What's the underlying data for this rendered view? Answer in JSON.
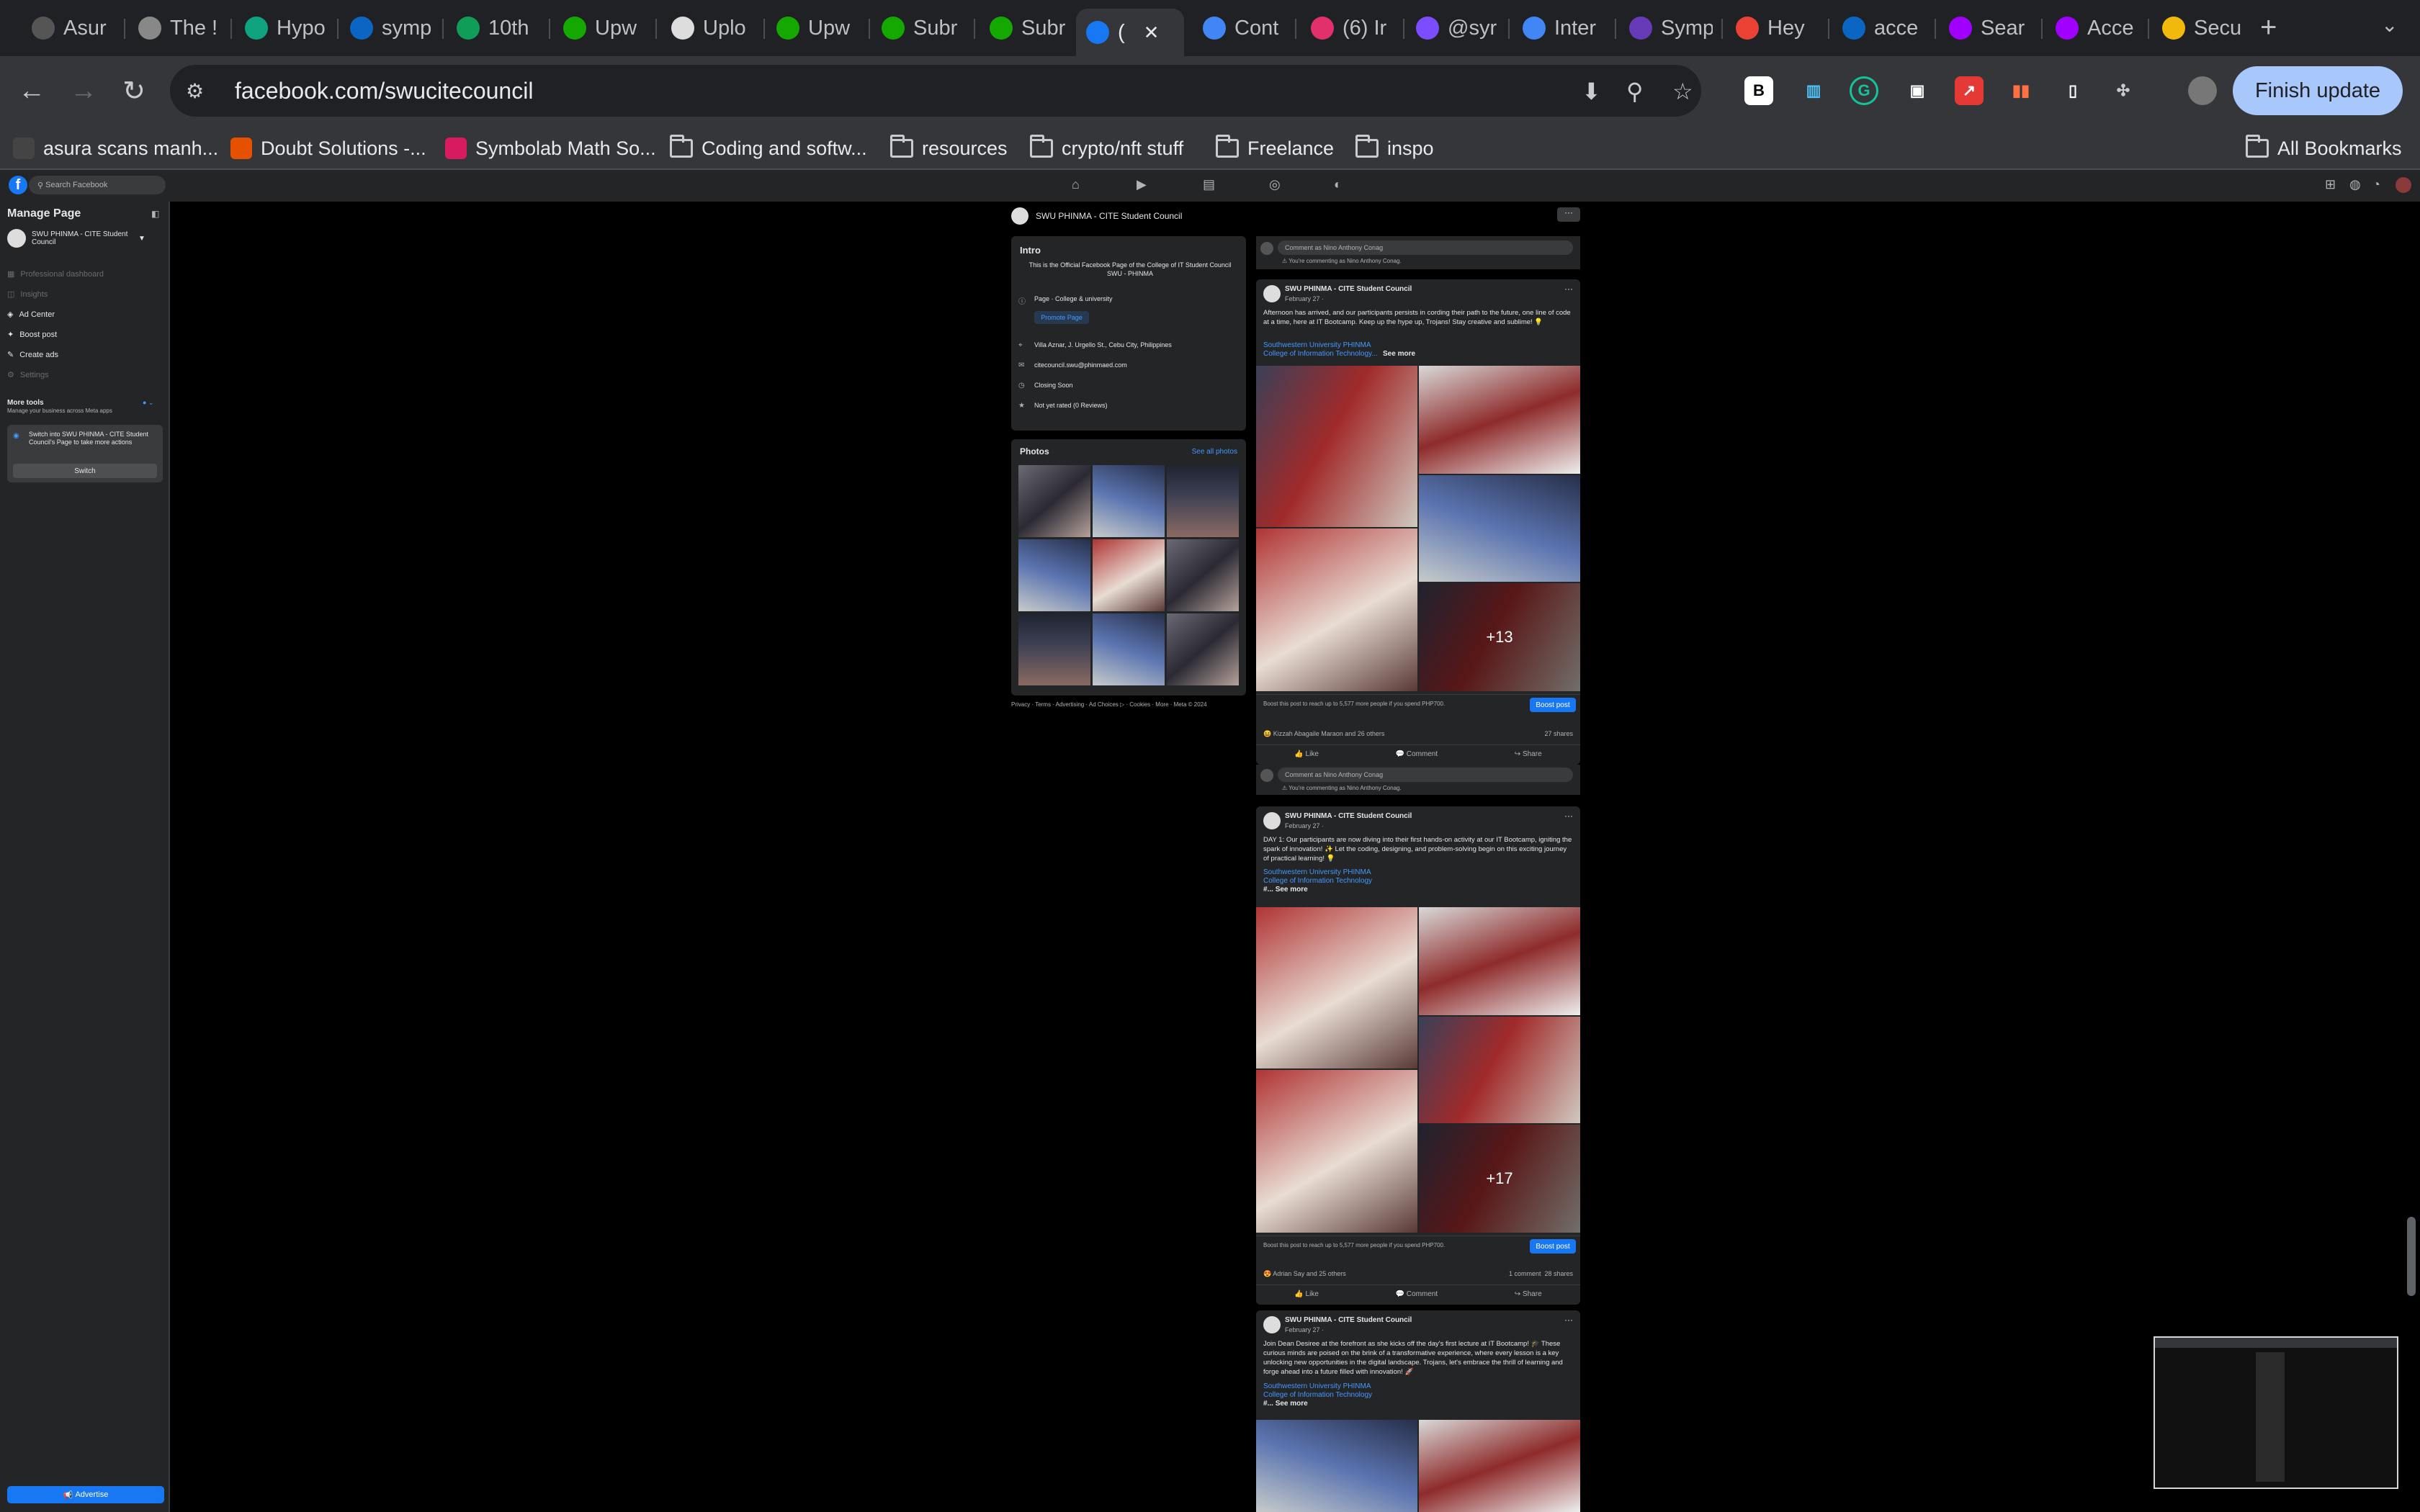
{
  "tabs": [
    {
      "label": "Asur",
      "icon": "asura-icon",
      "color": "#555"
    },
    {
      "label": "The !",
      "icon": "globe-icon",
      "color": "#888"
    },
    {
      "label": "Hypo",
      "icon": "openai-icon",
      "color": "#10a37f"
    },
    {
      "label": "symp",
      "icon": "linkedin-icon",
      "color": "#0a66c2"
    },
    {
      "label": "10th",
      "icon": "sheets-icon",
      "color": "#0f9d58"
    },
    {
      "label": "Upw",
      "icon": "upwork-icon",
      "color": "#14a800"
    },
    {
      "label": "Uplo",
      "icon": "github-icon",
      "color": "#ddd"
    },
    {
      "label": "Upw",
      "icon": "upwork-icon",
      "color": "#14a800"
    },
    {
      "label": "Subr",
      "icon": "upwork-icon",
      "color": "#14a800"
    },
    {
      "label": "Subr",
      "icon": "upwork-icon",
      "color": "#14a800"
    },
    {
      "label": "(",
      "icon": "facebook-icon",
      "color": "#1877f2",
      "active": true
    },
    {
      "label": "Cont",
      "icon": "contact-icon",
      "color": "#4285f4"
    },
    {
      "label": "(6) Ir",
      "icon": "instagram-icon",
      "color": "#e1306c"
    },
    {
      "label": "@syr",
      "icon": "link-icon",
      "color": "#7c4dff"
    },
    {
      "label": "Inter",
      "icon": "contact-icon",
      "color": "#4285f4"
    },
    {
      "label": "Symp",
      "icon": "form-icon",
      "color": "#673ab7"
    },
    {
      "label": "Hey",
      "icon": "gmail-icon",
      "color": "#ea4335"
    },
    {
      "label": "acce",
      "icon": "linkedin-icon",
      "color": "#0a66c2"
    },
    {
      "label": "Sear",
      "icon": "accenture-icon",
      "color": "#a100ff"
    },
    {
      "label": "Acce",
      "icon": "accenture-icon",
      "color": "#a100ff"
    },
    {
      "label": "Secu",
      "icon": "binance-icon",
      "color": "#f0b90b"
    }
  ],
  "url": "facebook.com/swucitecouncil",
  "finish_update": "Finish update",
  "bookmarks": [
    {
      "label": "asura scans manh...",
      "type": "site"
    },
    {
      "label": "Doubt Solutions -...",
      "type": "site"
    },
    {
      "label": "Symbolab Math So...",
      "type": "site"
    },
    {
      "label": "Coding and softw...",
      "type": "folder"
    },
    {
      "label": "resources",
      "type": "folder"
    },
    {
      "label": "crypto/nft stuff",
      "type": "folder"
    },
    {
      "label": "Freelance",
      "type": "folder"
    },
    {
      "label": "inspo",
      "type": "folder"
    }
  ],
  "all_bookmarks": "All Bookmarks",
  "fb": {
    "search_placeholder": "Search Facebook",
    "manage_page": "Manage Page",
    "page_name": "SWU PHINMA - CITE Student Council",
    "sidebar_items": [
      {
        "label": "Professional dashboard",
        "dim": true
      },
      {
        "label": "Insights",
        "dim": true
      },
      {
        "label": "Ad Center",
        "dim": false
      },
      {
        "label": "Boost post",
        "dim": false
      },
      {
        "label": "Create ads",
        "dim": false
      },
      {
        "label": "Settings",
        "dim": true
      }
    ],
    "more_tools": "More tools",
    "more_tools_sub": "Manage your business across Meta apps",
    "switch_text": "Switch into SWU PHINMA - CITE Student Council's Page to take more actions",
    "switch_btn": "Switch",
    "advertise": "Advertise",
    "intro": {
      "title": "Intro",
      "bio": "This is the Official Facebook Page of the College of IT Student Council SWU - PHINMA",
      "category": "Page · College & university",
      "promote": "Promote Page",
      "address": "Villa Aznar, J. Urgello St., Cebu City, Philippines",
      "email": "citecouncil.swu@phinmaed.com",
      "hours": "Closing Soon",
      "rating": "Not yet rated (0 Reviews)"
    },
    "photos_title": "Photos",
    "see_all_photos": "See all photos",
    "footer": "Privacy · Terms · Advertising · Ad Choices ▷ · Cookies · More · Meta © 2024",
    "commenting_placeholder": "Comment as Nino Anthony Conag",
    "commenting_note": "You're commenting as Nino Anthony Conag.",
    "posts": [
      {
        "author": "SWU PHINMA - CITE Student Council",
        "date": "February 27 · ",
        "text": "Afternoon has arrived, and our participants persists in cording their path to the future, one line of code at a time, here at IT Bootcamp. Keep up the hype up, Trojans! Stay creative and sublime! 💡",
        "link1": "Southwestern University PHINMA",
        "link2": "College of Information Technology...",
        "see_more": "See more",
        "more_count": "+13",
        "boost_text": "Boost this post to reach up to 5,577 more people if you spend PHP700.",
        "boost_btn": "Boost post",
        "reactions": "Kizzah Abagaile Maraon and 26 others",
        "stats": "27 shares",
        "like": "Like",
        "comment": "Comment",
        "share": "Share"
      },
      {
        "author": "SWU PHINMA - CITE Student Council",
        "date": "February 27 · ",
        "text": "DAY 1: Our participants are now diving into their first hands-on activity at our IT Bootcamp, igniting the spark of innovation! ✨ Let the coding, designing, and problem-solving begin on this exciting journey of practical learning! 💡",
        "link1": "Southwestern University PHINMA",
        "link2": "College of Information Technology",
        "see_more": "See more",
        "more_count": "+17",
        "boost_text": "Boost this post to reach up to 5,577 more people if you spend PHP700.",
        "boost_btn": "Boost post",
        "reactions": "Adrian Say and 25 others",
        "stats": "1 comment  28 shares",
        "like": "Like",
        "comment": "Comment",
        "share": "Share"
      },
      {
        "author": "SWU PHINMA - CITE Student Council",
        "date": "February 27 · ",
        "text": "Join Dean Desiree at the forefront as she kicks off the day's first lecture at IT Bootcamp! 🎓 These curious minds are poised on the brink of a transformative experience, where every lesson is a key unlocking new opportunities in the digital landscape. Trojans, let's embrace the thrill of learning and forge ahead into a future filled with innovation! 🚀",
        "link1": "Southwestern University PHINMA",
        "link2": "College of Information Technology",
        "see_more": "See more"
      }
    ]
  }
}
